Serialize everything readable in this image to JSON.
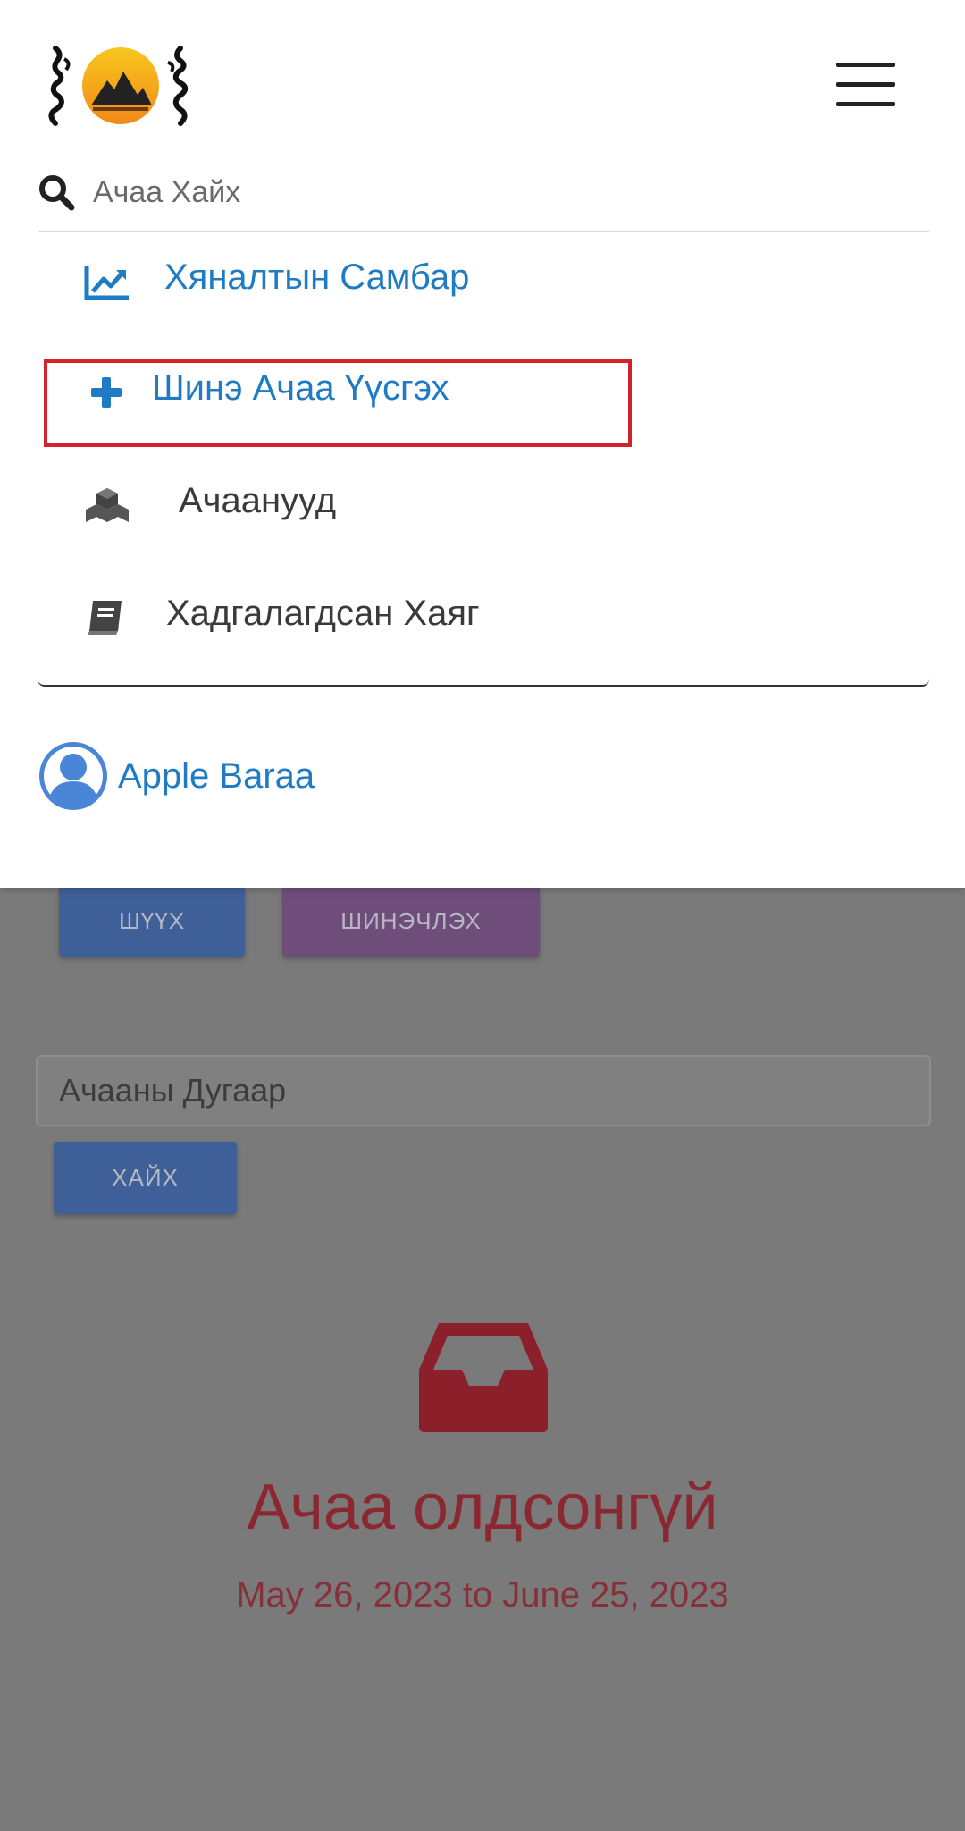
{
  "search": {
    "placeholder": "Ачаа Хайх"
  },
  "menu": {
    "items": [
      {
        "label": "Хяналтын Самбар",
        "icon": "chart-line-icon"
      },
      {
        "label": "Шинэ Ачаа Үүсгэх",
        "icon": "plus-icon"
      },
      {
        "label": "Ачаанууд",
        "icon": "cubes-icon"
      },
      {
        "label": "Хадгалагдсан Хаяг",
        "icon": "book-icon"
      }
    ]
  },
  "user": {
    "name": "Apple Baraa",
    "icon": "user-circle-icon"
  },
  "background": {
    "filter_button": "ШҮҮХ",
    "refresh_button": "ШИНЭЧЛЭХ",
    "shipment_number_field": "Ачааны Дугаар",
    "search_button": "ХАЙХ",
    "empty_icon": "inbox-icon",
    "empty_title": "Ачаа олдсонгүй",
    "date_range": "May 26, 2023 to June 25, 2023"
  },
  "colors": {
    "accent_blue": "#1e7bc4",
    "empty_red": "#8b2731",
    "highlight_red": "#d4222d"
  }
}
